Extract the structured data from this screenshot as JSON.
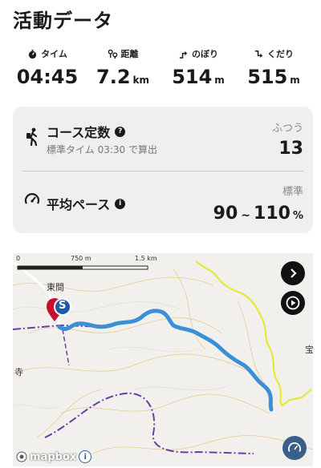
{
  "header": {
    "title": "活動データ"
  },
  "stats": {
    "time": {
      "label": "タイム",
      "value": "04:45",
      "unit": ""
    },
    "distance": {
      "label": "距離",
      "value": "7.2",
      "unit": "km"
    },
    "ascent": {
      "label": "のぼり",
      "value": "514",
      "unit": "m"
    },
    "descent": {
      "label": "くだり",
      "value": "515",
      "unit": "m"
    }
  },
  "course": {
    "title": "コース定数",
    "subtitle": "標準タイム 03:30 で算出",
    "level": "ふつう",
    "value": "13"
  },
  "pace": {
    "title": "平均ペース",
    "level": "標準",
    "value_min": "90",
    "tilde": "~",
    "value_max": "110",
    "unit": "%"
  },
  "map": {
    "scale_labels": [
      "0",
      "750 m",
      "1.5 km"
    ],
    "place_labels": [
      "東間",
      "寺",
      "宝"
    ],
    "start_marker": "S",
    "attribution": "mapbox",
    "info_button": "i"
  },
  "colors": {
    "route": "#3b8fd9",
    "trail_yellow": "#e6e832",
    "boundary_purple": "#6b3fa0",
    "card_bg": "#efefef",
    "start_red": "#c8102e",
    "start_blue": "#1e5aa8"
  }
}
